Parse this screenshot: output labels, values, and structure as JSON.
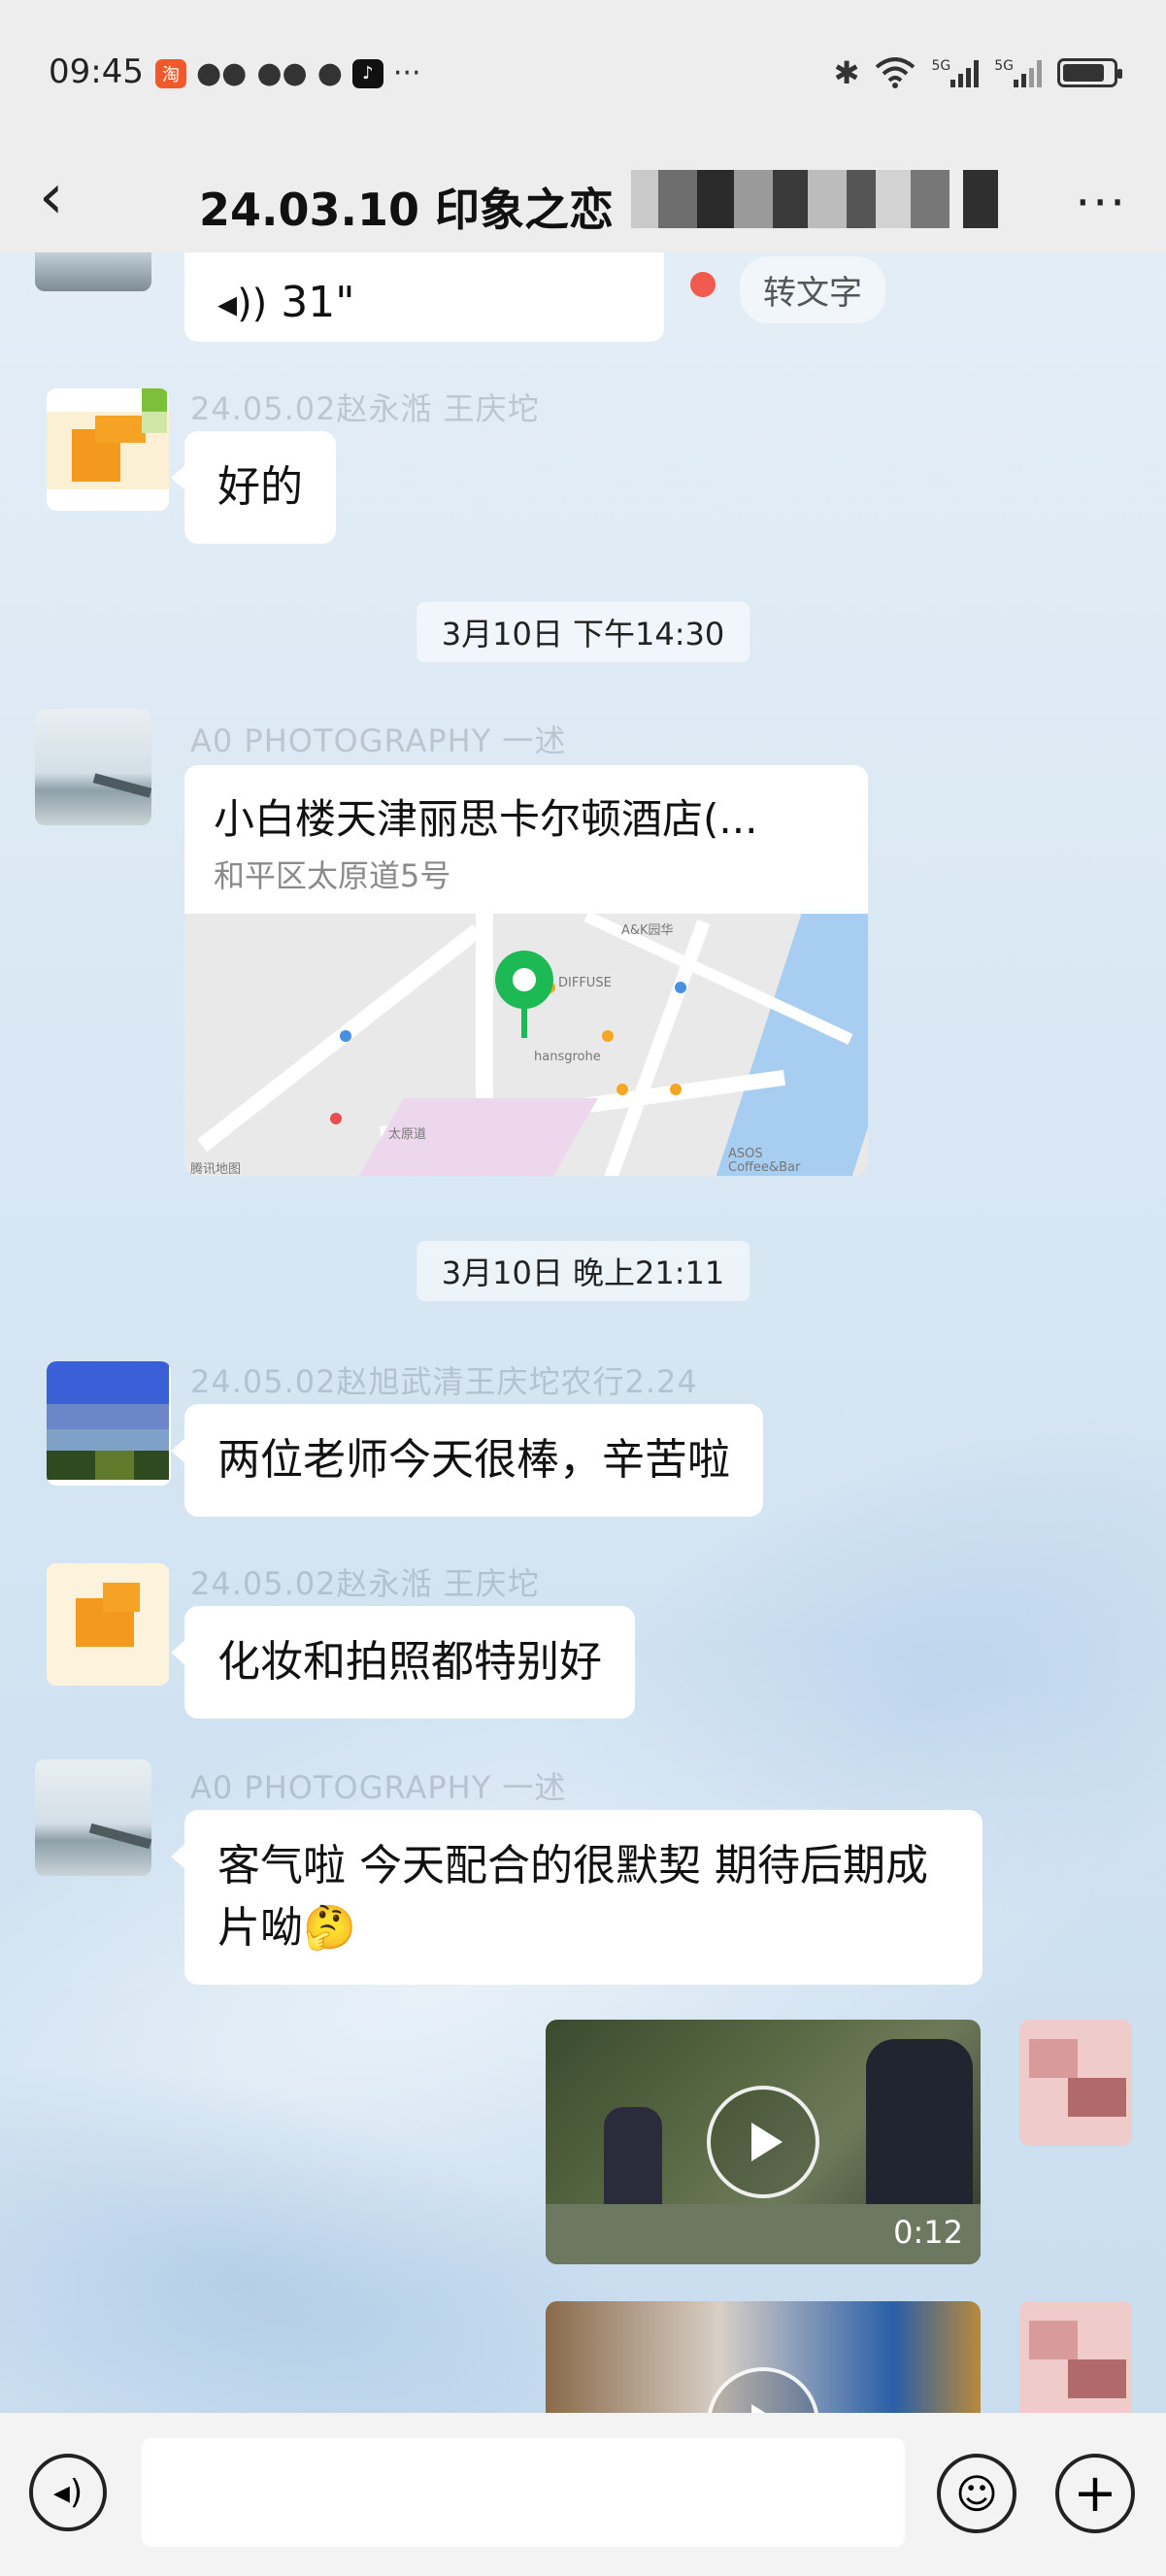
{
  "status_bar": {
    "time": "09:45",
    "more": "···",
    "network_1": "5G",
    "network_2": "5G"
  },
  "header": {
    "title": "24.03.10 印象之恋",
    "back_icon": "back-arrow-icon",
    "more_icon": "more-dots-icon",
    "more_label": "···"
  },
  "messages": {
    "voice": {
      "duration": "31\"",
      "to_text": "转文字"
    },
    "m1": {
      "sender": "24.05.02赵永湉 王庆坨",
      "text": "好的"
    },
    "ts1": "3月10日 下午14:30",
    "m2": {
      "sender": "A0 PHOTOGRAPHY 一述",
      "location_title": "小白楼天津丽思卡尔顿酒店(...",
      "location_address": "和平区太原道5号",
      "map_labels": {
        "a": "A&K园华",
        "b": "DIFFUSE",
        "c": "hansgrohe",
        "d": "ASOS",
        "e": "Coffee&Bar",
        "f": "腾讯地图",
        "g": "太原道"
      }
    },
    "ts2": "3月10日 晚上21:11",
    "m3": {
      "sender": "24.05.02赵旭武清王庆坨农行2.24",
      "text": "两位老师今天很棒，辛苦啦"
    },
    "m4": {
      "sender": "24.05.02赵永湉 王庆坨",
      "text": "化妆和拍照都特别好"
    },
    "m5": {
      "sender": "A0 PHOTOGRAPHY 一述",
      "text": "客气啦 今天配合的很默契  期待后期成片呦🤔"
    },
    "video1": {
      "duration": "0:12"
    }
  },
  "input_bar": {
    "voice_icon": "voice-input-icon",
    "emoji_icon": "emoji-icon",
    "plus_icon": "plus-icon",
    "placeholder": ""
  }
}
